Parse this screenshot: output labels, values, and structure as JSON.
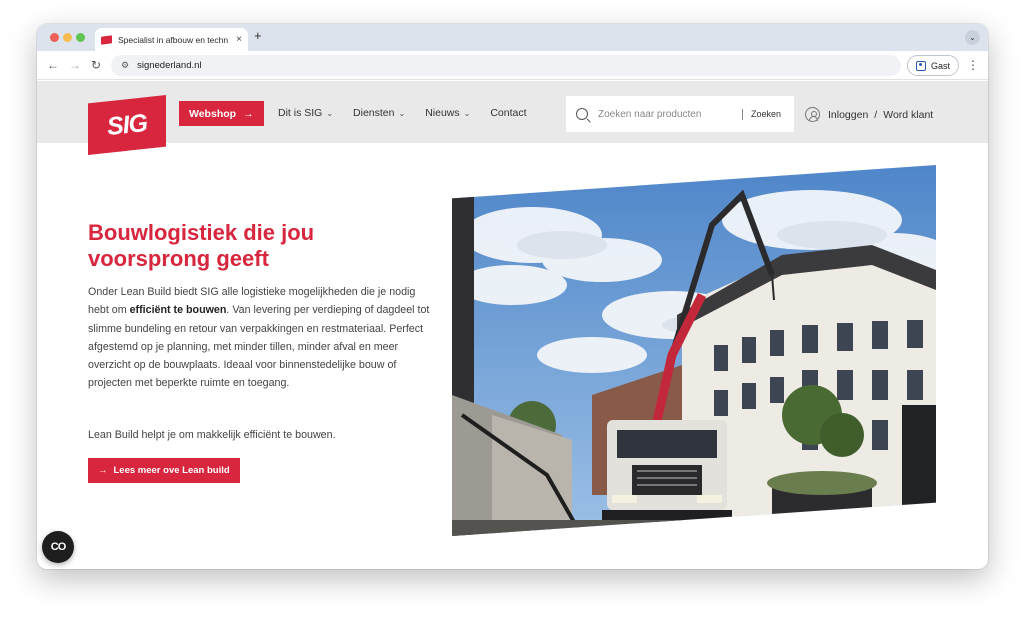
{
  "browser": {
    "tab_title": "Specialist in afbouw en techn",
    "tab_close": "×",
    "new_tab": "+",
    "tab_menu": "⌄",
    "back": "←",
    "forward": "→",
    "reload": "↻",
    "site_info": "⚙",
    "url": "signederland.nl",
    "profile_label": "Gast",
    "menu": "⋮"
  },
  "header": {
    "logo_text": "SIG",
    "webshop_label": "Webshop",
    "webshop_arrow": "→",
    "nav": [
      {
        "label": "Dit is SIG",
        "chevron": "⌄"
      },
      {
        "label": "Diensten",
        "chevron": "⌄"
      },
      {
        "label": "Nieuws",
        "chevron": "⌄"
      },
      {
        "label": "Contact"
      }
    ],
    "search": {
      "placeholder": "Zoeken naar producten",
      "button": "Zoeken"
    },
    "login": "Inloggen",
    "separator": "/",
    "register": "Word klant"
  },
  "hero": {
    "title": "Bouwlogistiek die jou voorsprong geeft",
    "text_before": "Onder Lean Build biedt SIG alle logistieke mogelijkheden die je nodig hebt om ",
    "text_bold": "efficiënt te bouwen",
    "text_after": ". Van levering per verdieping of dagdeel tot slimme bundeling en retour van verpakkingen en restmateriaal. Perfect afgestemd op je planning, met minder tillen, minder afval en meer overzicht op de bouwplaats. Ideaal voor binnenstedelijke bouw of projecten met beperkte ruimte en toegang.",
    "subtext": "Lean Build helpt je om makkelijk efficiënt te bouwen.",
    "cta_arrow": "→",
    "cta_label": "Lees meer ove Lean build"
  },
  "chat_button": "CO",
  "colors": {
    "brand_red": "#d7263d",
    "header_bg": "#e9e9e9"
  }
}
